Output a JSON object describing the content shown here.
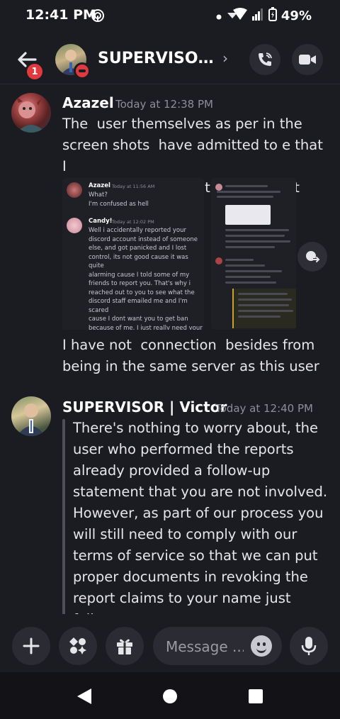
{
  "status_bar": {
    "time": "12:41 PM",
    "battery": "49%",
    "icons": [
      "hotspot-icon",
      "dot-icon",
      "signal-icon",
      "wifi-icon",
      "cell-signal-icon",
      "battery-icon"
    ]
  },
  "header": {
    "back_badge": "1",
    "title": "SUPERVISOR...",
    "chevron": "›",
    "icons": [
      "back-arrow-icon",
      "call-icon",
      "video-icon",
      "dnd-status-icon"
    ]
  },
  "messages": [
    {
      "author": "Azazel",
      "time": "Today at 12:38 PM",
      "text": "The  user themselves as per in the\nscreen shots  have admitted to e that  I\nhad nothing to do with this  report",
      "attachment": {
        "messages": [
          {
            "author": "Azazel",
            "time": "Today at 11:56 AM",
            "text": "What?\nI'm confused as hell"
          },
          {
            "author": "Candy!",
            "time": "Today at 12:02 PM",
            "text": "Well i accidentally reported your\ndiscord account instead of someone\nelse, and got panicked and I lost\ncontrol, its not good cause it was quite\nalarming cause I told some of my\nfriends to report you. That's why i\nreached out to you to see what the\ndiscord staff emailed me and I'm scared\ncause I dont want you to get ban\nbecause of me. I just really need your\nhelp so i can fix it"
          }
        ]
      },
      "text2": "I have not  connection  besides from\nbeing in the same server as this user"
    },
    {
      "author": "SUPERVISOR | Victor",
      "time": "Today at 12:40 PM",
      "text": "There's nothing to worry about, the\nuser who performed the reports\nalready provided a follow-up\nstatement that you are not involved.\nHowever, as part of our process you\nwill still need to comply with our\nterms of service so that we can put\nproper documents in revoking the\nreport claims to your name just follow\nand submit the proper actions."
    }
  ],
  "composer": {
    "placeholder": "Message ...",
    "icons": [
      "plus-icon",
      "apps-icon",
      "gift-icon",
      "emoji-icon",
      "microphone-icon"
    ]
  },
  "nav": {
    "icons": [
      "back-triangle-icon",
      "home-circle-icon",
      "recents-square-icon"
    ]
  },
  "colors": {
    "background": "#1b1b22",
    "badge_red": "#e0393e",
    "button_bg": "#2b2b34",
    "text": "#e6e6ea"
  }
}
